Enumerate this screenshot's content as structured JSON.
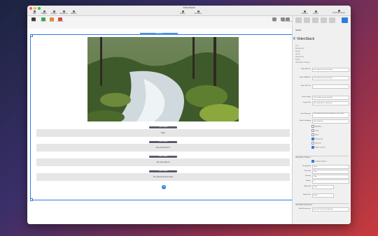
{
  "window": {
    "title": "VideoStack"
  },
  "toolbar": [
    {
      "label": "Add",
      "icon": "plus-icon"
    },
    {
      "label": "Widgets",
      "icon": "widgets-icon"
    },
    {
      "label": "Chapter",
      "icon": "chapter-icon"
    },
    {
      "label": "Resources",
      "icon": "folder-icon"
    },
    {
      "label": "Variants",
      "icon": "layers-icon"
    },
    {
      "label": "Modes",
      "icon": "mode-icon"
    },
    {
      "label": "Animation",
      "icon": "animation-icon"
    },
    {
      "label": "Publishing Setup",
      "icon": "gear-icon"
    },
    {
      "label": "Preview",
      "icon": "eye-icon"
    },
    {
      "label": "Export",
      "icon": "export-icon"
    }
  ],
  "toolbar2": [
    {
      "label": "Library",
      "color": "#3a3a3a"
    },
    {
      "label": "Default",
      "color": "#3aa64a"
    },
    {
      "label": "Smoke",
      "color": "#e08a2a"
    },
    {
      "label": "Keyframe",
      "color": "#d64545"
    }
  ],
  "toolbar2_right": [
    "View",
    "Lock",
    "Performance"
  ],
  "canvas": {
    "header": "VideoStack",
    "chapter_label": "Video Chapter",
    "chapters": [
      "Start",
      "Five Seconds In",
      "Ten Seconds In",
      "Ten Seconds from End"
    ],
    "add_symbol": "+"
  },
  "sidebar": {
    "tab_label": "Stacks",
    "title": "VideoStack",
    "general": [
      "Info",
      "Background",
      "Border",
      "Layout",
      "Responsive",
      "Modes",
      "VideoStack Settings"
    ],
    "fields": [
      {
        "label": "Video MP4 Url",
        "value": "files.videostack.com/stream..."
      },
      {
        "label": "Video WEBM Url",
        "value": "files.videostack.com/stream..."
      },
      {
        "label": "Video OGV Url",
        "value": ""
      },
      {
        "label": "Poster Image",
        "value": "Placeholder Image (default)"
      },
      {
        "label": "Image URL",
        "value": "files.videostack.com/poster..."
      },
      {
        "label": "Error Message",
        "value": "Your browser does not support HTML5 video."
      },
      {
        "label": "Video Preloading",
        "value": "Auto (Default)"
      }
    ],
    "checkboxes": [
      {
        "label": "Autoplay",
        "on": false
      },
      {
        "label": "Loop",
        "on": false
      },
      {
        "label": "Mute",
        "on": false
      },
      {
        "label": "Responsive",
        "on": true
      },
      {
        "label": "Show UI",
        "on": false
      },
      {
        "label": "Video Controls",
        "on": true
      }
    ],
    "sec2": "VideoStack Chapters",
    "display_chapters": "Display Chapters",
    "chapter_fields": [
      {
        "label": "Background",
        "value": "None"
      },
      {
        "label": "Font Size",
        "value": "12px"
      },
      {
        "label": "Spacing",
        "value": "10px"
      },
      {
        "label": "Radius",
        "value": "0"
      },
      {
        "label": "Button Fill",
        "value": "Gray"
      },
      {
        "label": "Button Text",
        "value": "White"
      }
    ],
    "sec3": "VideoStack Responsive",
    "video_responsive": {
      "label": "Video Responsive",
      "value": "Set max Page Size (default)"
    }
  }
}
